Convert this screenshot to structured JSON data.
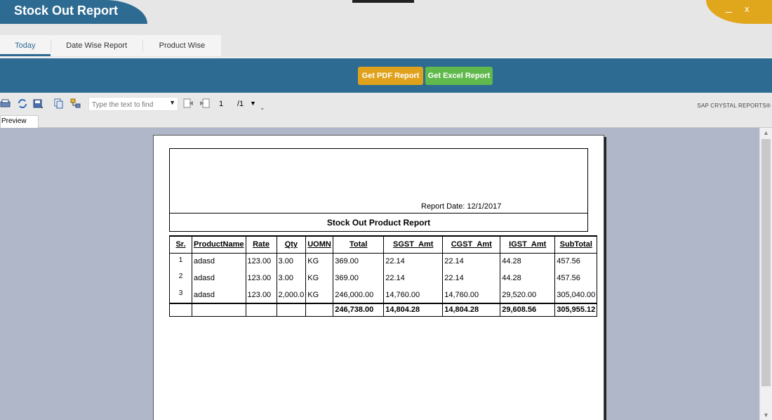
{
  "window": {
    "title": "Stock Out Report",
    "minimize_label": "_",
    "close_label": "x",
    "accent_color": "#2e6b92",
    "control_color": "#e0a71c"
  },
  "tabs": [
    {
      "label": "Today",
      "active": true
    },
    {
      "label": "Date Wise Report",
      "active": false
    },
    {
      "label": "Product Wise",
      "active": false
    }
  ],
  "actions": {
    "pdf_label": "Get PDF Report",
    "excel_label": "Get Excel Report",
    "pdf_color": "#e0a21c",
    "excel_color": "#5fb94c"
  },
  "toolbar": {
    "find_placeholder": "Type the text to find",
    "current_page": "1",
    "total_pages": "/1",
    "brand": "SAP CRYSTAL REPORTS®",
    "icons": [
      "export-icon",
      "refresh-icon",
      "print-icon",
      "copy-icon",
      "group-tree-icon",
      "find-dropdown-icon",
      "prev-page-icon",
      "next-page-icon"
    ]
  },
  "preview_tab": "Preview",
  "report": {
    "date_label": "Report Date: 12/1/2017",
    "title": "Stock Out Product Report",
    "columns": [
      "Sr.",
      "ProductName",
      "Rate",
      "Qty",
      "UOMN",
      "Total",
      "SGST_Amt",
      "CGST_Amt",
      "IGST_Amt",
      "SubTotal"
    ],
    "rows": [
      [
        "1",
        "adasd",
        "123.00",
        "3.00",
        "KG",
        "369.00",
        "22.14",
        "22.14",
        "44.28",
        "457.56"
      ],
      [
        "2",
        "adasd",
        "123.00",
        "3.00",
        "KG",
        "369.00",
        "22.14",
        "22.14",
        "44.28",
        "457.56"
      ],
      [
        "3",
        "adasd",
        "123.00",
        "2,000.0",
        "KG",
        "246,000.00",
        "14,760.00",
        "14,760.00",
        "29,520.00",
        "305,040.00"
      ]
    ],
    "totals": [
      "",
      "",
      "",
      "",
      "",
      "246,738.00",
      "14,804.28",
      "14,804.28",
      "29,608.56",
      "305,955.12"
    ]
  }
}
